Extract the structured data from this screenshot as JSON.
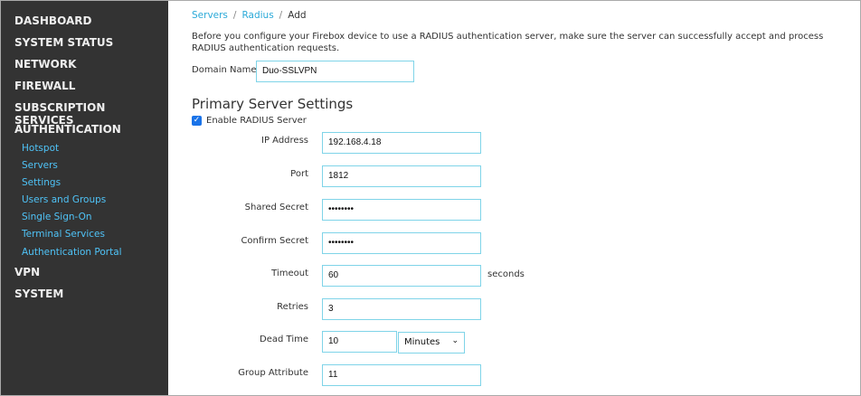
{
  "sidebar": {
    "top": [
      "DASHBOARD",
      "SYSTEM STATUS",
      "NETWORK",
      "FIREWALL",
      "SUBSCRIPTION SERVICES",
      "AUTHENTICATION"
    ],
    "auth_items": [
      "Hotspot",
      "Servers",
      "Settings",
      "Users and Groups",
      "Single Sign-On",
      "Terminal Services",
      "Authentication Portal"
    ],
    "bottom": [
      "VPN",
      "SYSTEM"
    ]
  },
  "breadcrumb": {
    "servers": "Servers",
    "radius": "Radius",
    "current": "Add",
    "sep": "/"
  },
  "intro": "Before you configure your Firebox device to use a RADIUS authentication server, make sure the server can successfully accept and process RADIUS authentication requests.",
  "domain": {
    "label": "Domain Name",
    "value": "Duo-SSLVPN"
  },
  "section_title": "Primary Server Settings",
  "enable": {
    "label": "Enable RADIUS Server",
    "checked": true
  },
  "fields": [
    {
      "label": "IP Address",
      "value": "192.168.4.18"
    },
    {
      "label": "Port",
      "value": "1812"
    },
    {
      "label": "Shared Secret",
      "value": "••••••••"
    },
    {
      "label": "Confirm Secret",
      "value": "••••••••"
    },
    {
      "label": "Timeout",
      "value": "60"
    },
    {
      "label": "Retries",
      "value": "3"
    },
    {
      "label": "Dead Time",
      "value": "10"
    },
    {
      "label": "Group Attribute",
      "value": "11"
    }
  ],
  "timeout_unit": "seconds",
  "dead_time_unit": "Minutes"
}
